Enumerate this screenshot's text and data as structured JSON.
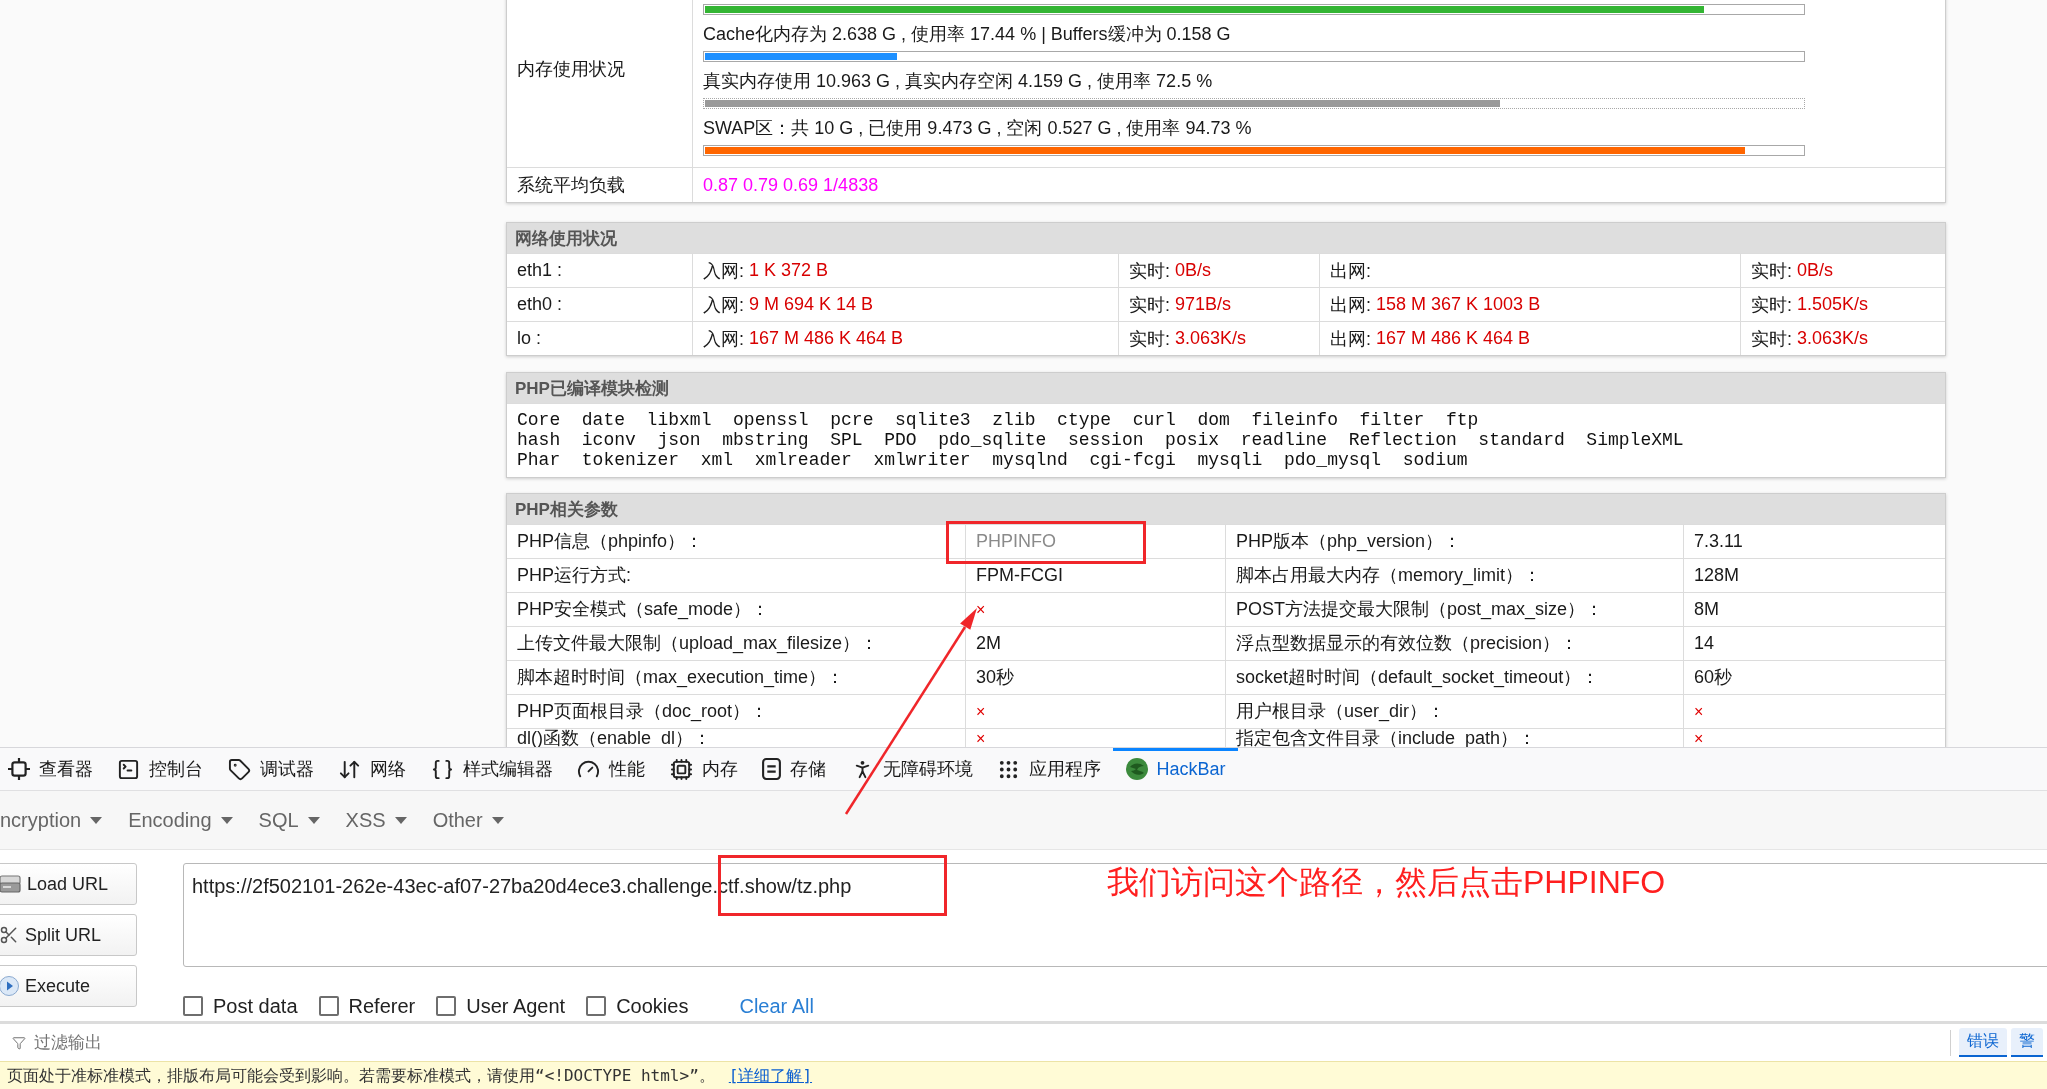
{
  "memory": {
    "label": "内存使用状况",
    "bars": [
      {
        "kind": "solid",
        "level": 0.91,
        "color": "#33b533"
      },
      {
        "text": "Cache化内存为 2.638 G , 使用率 17.44 % | Buffers缓冲为 0.158 G",
        "kind": "solid",
        "level": 0.175,
        "color": "#1e90ff"
      },
      {
        "text": "真实内存使用 10.963 G , 真实内存空闲 4.159 G , 使用率 72.5 %",
        "kind": "dotted",
        "level": 0.724,
        "color": "#999999"
      },
      {
        "text": "SWAP区：共 10 G , 已使用 9.473 G , 空闲 0.527 G , 使用率 94.73 %",
        "kind": "solid",
        "level": 0.947,
        "color": "#ff6600"
      }
    ]
  },
  "load": {
    "label": "系统平均负载",
    "value": "0.87 0.79 0.69 1/4838"
  },
  "network": {
    "title": "网络使用状况",
    "rows": [
      {
        "name": "eth1 :",
        "cells": [
          {
            "label": "入网:",
            "value": "1 K 372 B"
          },
          {
            "label": "实时:",
            "value": "0B/s"
          },
          {
            "label": "出网:"
          },
          {
            "label": "实时:",
            "value": "0B/s"
          }
        ]
      },
      {
        "name": "eth0 :",
        "cells": [
          {
            "label": "入网:",
            "value": "9 M 694 K 14 B"
          },
          {
            "label": "实时:",
            "value": "971B/s"
          },
          {
            "label": "出网:",
            "value": "158 M 367 K 1003 B"
          },
          {
            "label": "实时:",
            "value": "1.505K/s"
          }
        ]
      },
      {
        "name": "lo :",
        "cells": [
          {
            "label": "入网:",
            "value": "167 M 486 K 464 B"
          },
          {
            "label": "实时:",
            "value": "3.063K/s"
          },
          {
            "label": "出网:",
            "value": "167 M 486 K 464 B"
          },
          {
            "label": "实时:",
            "value": "3.063K/s"
          }
        ]
      }
    ]
  },
  "modules": {
    "title": "PHP已编译模块检测",
    "lines": [
      "Core  date  libxml  openssl  pcre  sqlite3  zlib  ctype  curl  dom  fileinfo  filter  ftp",
      "hash  iconv  json  mbstring  SPL  PDO  pdo_sqlite  session  posix  readline  Reflection  standard  SimpleXML",
      "Phar  tokenizer  xml  xmlreader  xmlwriter  mysqlnd  cgi-fcgi  mysqli  pdo_mysql  sodium"
    ]
  },
  "params": {
    "title": "PHP相关参数",
    "rows": [
      [
        {
          "kind": "label",
          "text": "PHP信息（phpinfo）："
        },
        {
          "kind": "link",
          "text": "PHPINFO"
        },
        {
          "kind": "label",
          "text": "PHP版本（php_version）："
        },
        {
          "kind": "text",
          "text": "7.3.11"
        }
      ],
      [
        {
          "kind": "label",
          "text": "PHP运行方式:"
        },
        {
          "kind": "text",
          "text": "FPM-FCGI"
        },
        {
          "kind": "label",
          "text": "脚本占用最大内存（memory_limit）："
        },
        {
          "kind": "text",
          "text": "128M"
        }
      ],
      [
        {
          "kind": "label",
          "text": "PHP安全模式（safe_mode）："
        },
        {
          "kind": "cross",
          "text": "×"
        },
        {
          "kind": "label",
          "text": "POST方法提交最大限制（post_max_size）："
        },
        {
          "kind": "text",
          "text": "8M"
        }
      ],
      [
        {
          "kind": "label",
          "text": "上传文件最大限制（upload_max_filesize）："
        },
        {
          "kind": "text",
          "text": "2M"
        },
        {
          "kind": "label",
          "text": "浮点型数据显示的有效位数（precision）："
        },
        {
          "kind": "text",
          "text": "14"
        }
      ],
      [
        {
          "kind": "label",
          "text": "脚本超时时间（max_execution_time）："
        },
        {
          "kind": "text",
          "text": "30秒"
        },
        {
          "kind": "label",
          "text": "socket超时时间（default_socket_timeout）："
        },
        {
          "kind": "text",
          "text": "60秒"
        }
      ],
      [
        {
          "kind": "label",
          "text": "PHP页面根目录（doc_root）："
        },
        {
          "kind": "cross",
          "text": "×"
        },
        {
          "kind": "label",
          "text": "用户根目录（user_dir）："
        },
        {
          "kind": "cross",
          "text": "×"
        }
      ],
      [
        {
          "kind": "label",
          "text": "dl()函数（enable_dl）："
        },
        {
          "kind": "cross",
          "text": "×"
        },
        {
          "kind": "label",
          "text": "指定包含文件目录（include_path）："
        },
        {
          "kind": "cross",
          "text": "×"
        }
      ]
    ]
  },
  "devtools": {
    "tabs": [
      {
        "label": "查看器",
        "selected": false
      },
      {
        "label": "控制台",
        "selected": false
      },
      {
        "label": "调试器",
        "selected": false
      },
      {
        "label": "网络",
        "selected": false
      },
      {
        "label": "样式编辑器",
        "selected": false
      },
      {
        "label": "性能",
        "selected": false
      },
      {
        "label": "内存",
        "selected": false
      },
      {
        "label": "存储",
        "selected": false
      },
      {
        "label": "无障碍环境",
        "selected": false
      },
      {
        "label": "应用程序",
        "selected": false
      },
      {
        "label": "HackBar",
        "selected": true
      }
    ]
  },
  "hackbar": {
    "menus": [
      "ncryption",
      "Encoding",
      "SQL",
      "XSS",
      "Other"
    ],
    "buttons": [
      "Load URL",
      "Split URL",
      "Execute"
    ],
    "url": "https://2f502101-262e-43ec-af07-27ba20d4ece3.challenge.ctf.show/tz.php",
    "options": [
      {
        "label": "Post data",
        "checked": false
      },
      {
        "label": "Referer",
        "checked": false
      },
      {
        "label": "User Agent",
        "checked": false
      },
      {
        "label": "Cookies",
        "checked": false
      }
    ],
    "clear": "Clear All"
  },
  "console": {
    "filter_placeholder": "过滤输出",
    "filters": [
      {
        "label": "错误",
        "on": true
      },
      {
        "label": "警",
        "on": true
      }
    ]
  },
  "notice": {
    "text": "页面处于准标准模式，排版布局可能会受到影响。若需要标准模式，请使用“<!DOCTYPE html>”。",
    "link": "[详细了解]"
  },
  "annotation": {
    "note": "我们访问这个路径，然后点击PHPINFO"
  }
}
